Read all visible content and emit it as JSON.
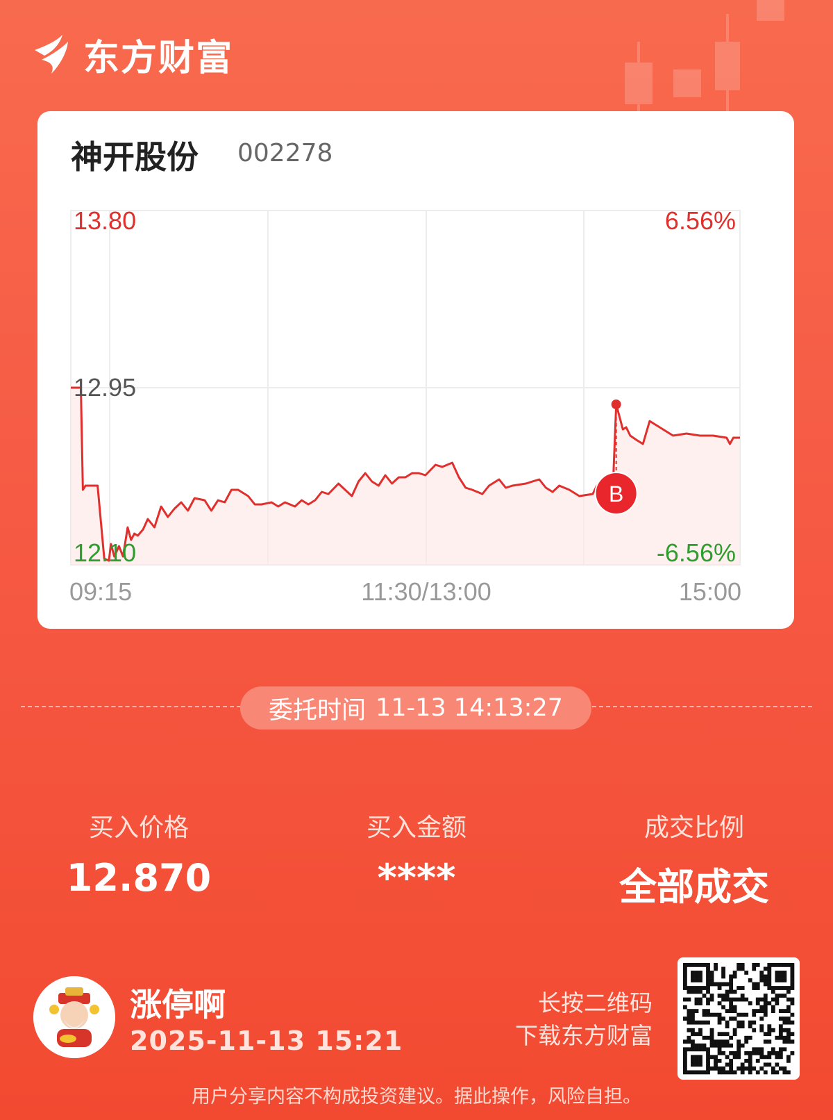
{
  "brand": {
    "name": "东方财富"
  },
  "stock": {
    "name": "神开股份",
    "code": "002278"
  },
  "chart_data": {
    "type": "line",
    "title": "",
    "y_price_labels": {
      "top": "13.80",
      "mid": "12.95",
      "bottom": "12.10"
    },
    "y_pct_labels": {
      "top": "6.56%",
      "bottom": "-6.56%"
    },
    "x_labels": [
      "09:15",
      "11:30/13:00",
      "15:00"
    ],
    "ylim": [
      12.1,
      13.8
    ],
    "xlim": [
      0,
      1
    ],
    "grid": true,
    "series": [
      {
        "x": [
          0,
          0.015,
          0.018,
          0.022,
          0.03,
          0.04,
          0.05,
          0.057,
          0.06,
          0.065,
          0.072,
          0.078,
          0.085,
          0.09,
          0.095,
          0.1,
          0.108,
          0.115,
          0.125,
          0.135,
          0.145,
          0.155,
          0.165,
          0.175,
          0.185,
          0.2,
          0.21,
          0.22,
          0.23,
          0.24,
          0.25,
          0.265,
          0.275,
          0.285,
          0.3,
          0.31,
          0.32,
          0.335,
          0.345,
          0.355,
          0.365,
          0.375,
          0.385,
          0.4,
          0.41,
          0.42,
          0.43,
          0.44,
          0.45,
          0.46,
          0.47,
          0.48,
          0.49,
          0.5,
          0.51,
          0.52,
          0.53,
          0.545,
          0.555,
          0.57,
          0.58,
          0.59,
          0.6,
          0.615,
          0.625,
          0.64,
          0.65,
          0.66,
          0.68,
          0.7,
          0.71,
          0.72,
          0.73,
          0.745,
          0.76,
          0.78,
          0.786,
          0.795,
          0.81,
          0.815,
          0.825,
          0.83,
          0.836,
          0.845,
          0.855,
          0.865,
          0.875,
          0.89,
          0.9,
          0.92,
          0.94,
          0.96,
          0.98,
          0.985,
          0.99,
          1.0
        ],
        "y": [
          12.95,
          12.95,
          12.46,
          12.48,
          12.48,
          12.48,
          12.13,
          12.12,
          12.2,
          12.14,
          12.19,
          12.14,
          12.28,
          12.22,
          12.25,
          12.24,
          12.27,
          12.32,
          12.28,
          12.38,
          12.33,
          12.37,
          12.4,
          12.36,
          12.42,
          12.41,
          12.36,
          12.41,
          12.4,
          12.46,
          12.46,
          12.43,
          12.39,
          12.39,
          12.4,
          12.38,
          12.4,
          12.38,
          12.41,
          12.39,
          12.41,
          12.45,
          12.44,
          12.49,
          12.46,
          12.43,
          12.5,
          12.54,
          12.5,
          12.48,
          12.53,
          12.49,
          12.52,
          12.52,
          12.54,
          12.54,
          12.53,
          12.58,
          12.57,
          12.59,
          12.52,
          12.47,
          12.46,
          12.44,
          12.48,
          12.51,
          12.47,
          12.48,
          12.49,
          12.51,
          12.47,
          12.45,
          12.48,
          12.46,
          12.43,
          12.44,
          12.48,
          12.49,
          12.46,
          12.87,
          12.75,
          12.76,
          12.72,
          12.7,
          12.68,
          12.79,
          12.77,
          12.74,
          12.72,
          12.73,
          12.72,
          12.72,
          12.71,
          12.68,
          12.71,
          12.71
        ]
      }
    ],
    "marker": {
      "label": "B",
      "price": 12.87
    }
  },
  "order": {
    "label": "委托时间",
    "time": "11-13 14:13:27"
  },
  "stats": [
    {
      "label": "买入价格",
      "value": "12.870"
    },
    {
      "label": "买入金额",
      "value": "****"
    },
    {
      "label": "成交比例",
      "value": "全部成交"
    }
  ],
  "user": {
    "name": "涨停啊",
    "time": "2025-11-13 15:21"
  },
  "qr": {
    "line1": "长按二维码",
    "line2": "下载东方财富"
  },
  "disclaimer": "用户分享内容不构成投资建议。据此操作，风险自担。",
  "colors": {
    "up": "#e0302e",
    "down": "#2e9d2e",
    "accent": "#f65a44"
  }
}
